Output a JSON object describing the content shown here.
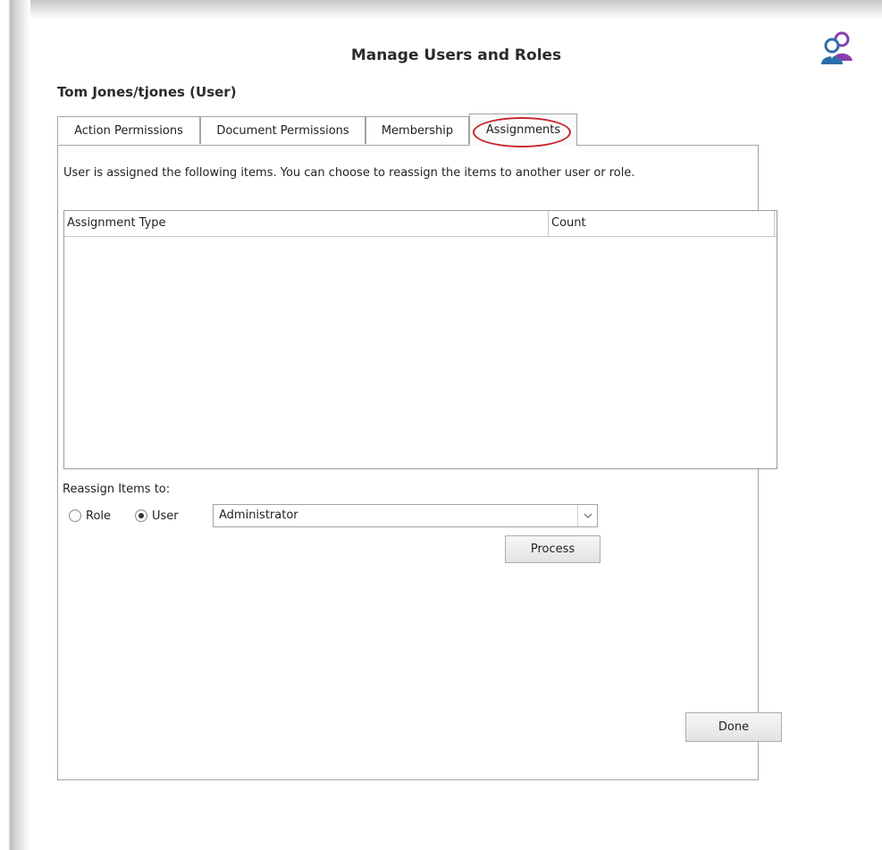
{
  "dialog": {
    "title": "Manage Users and Roles",
    "icon": "users-roles-icon",
    "user_heading": "Tom Jones/tjones (User)"
  },
  "tabs": [
    {
      "label": "Action Permissions",
      "active": false
    },
    {
      "label": "Document Permissions",
      "active": false
    },
    {
      "label": "Membership",
      "active": false
    },
    {
      "label": "Assignments",
      "active": true
    }
  ],
  "assignments": {
    "description": "User is assigned the following items. You can choose to reassign the items to another user or role.",
    "columns": [
      "Assignment Type",
      "Count"
    ],
    "rows": [],
    "reassign_label": "Reassign Items to:",
    "radio_role_label": "Role",
    "radio_user_label": "User",
    "selected_radio": "User",
    "selected_user": "Administrator",
    "process_label": "Process"
  },
  "footer": {
    "done_label": "Done"
  },
  "colors": {
    "highlight": "#c8262d",
    "icon_blue": "#2e6ea8",
    "icon_purple": "#8a3fb0"
  }
}
